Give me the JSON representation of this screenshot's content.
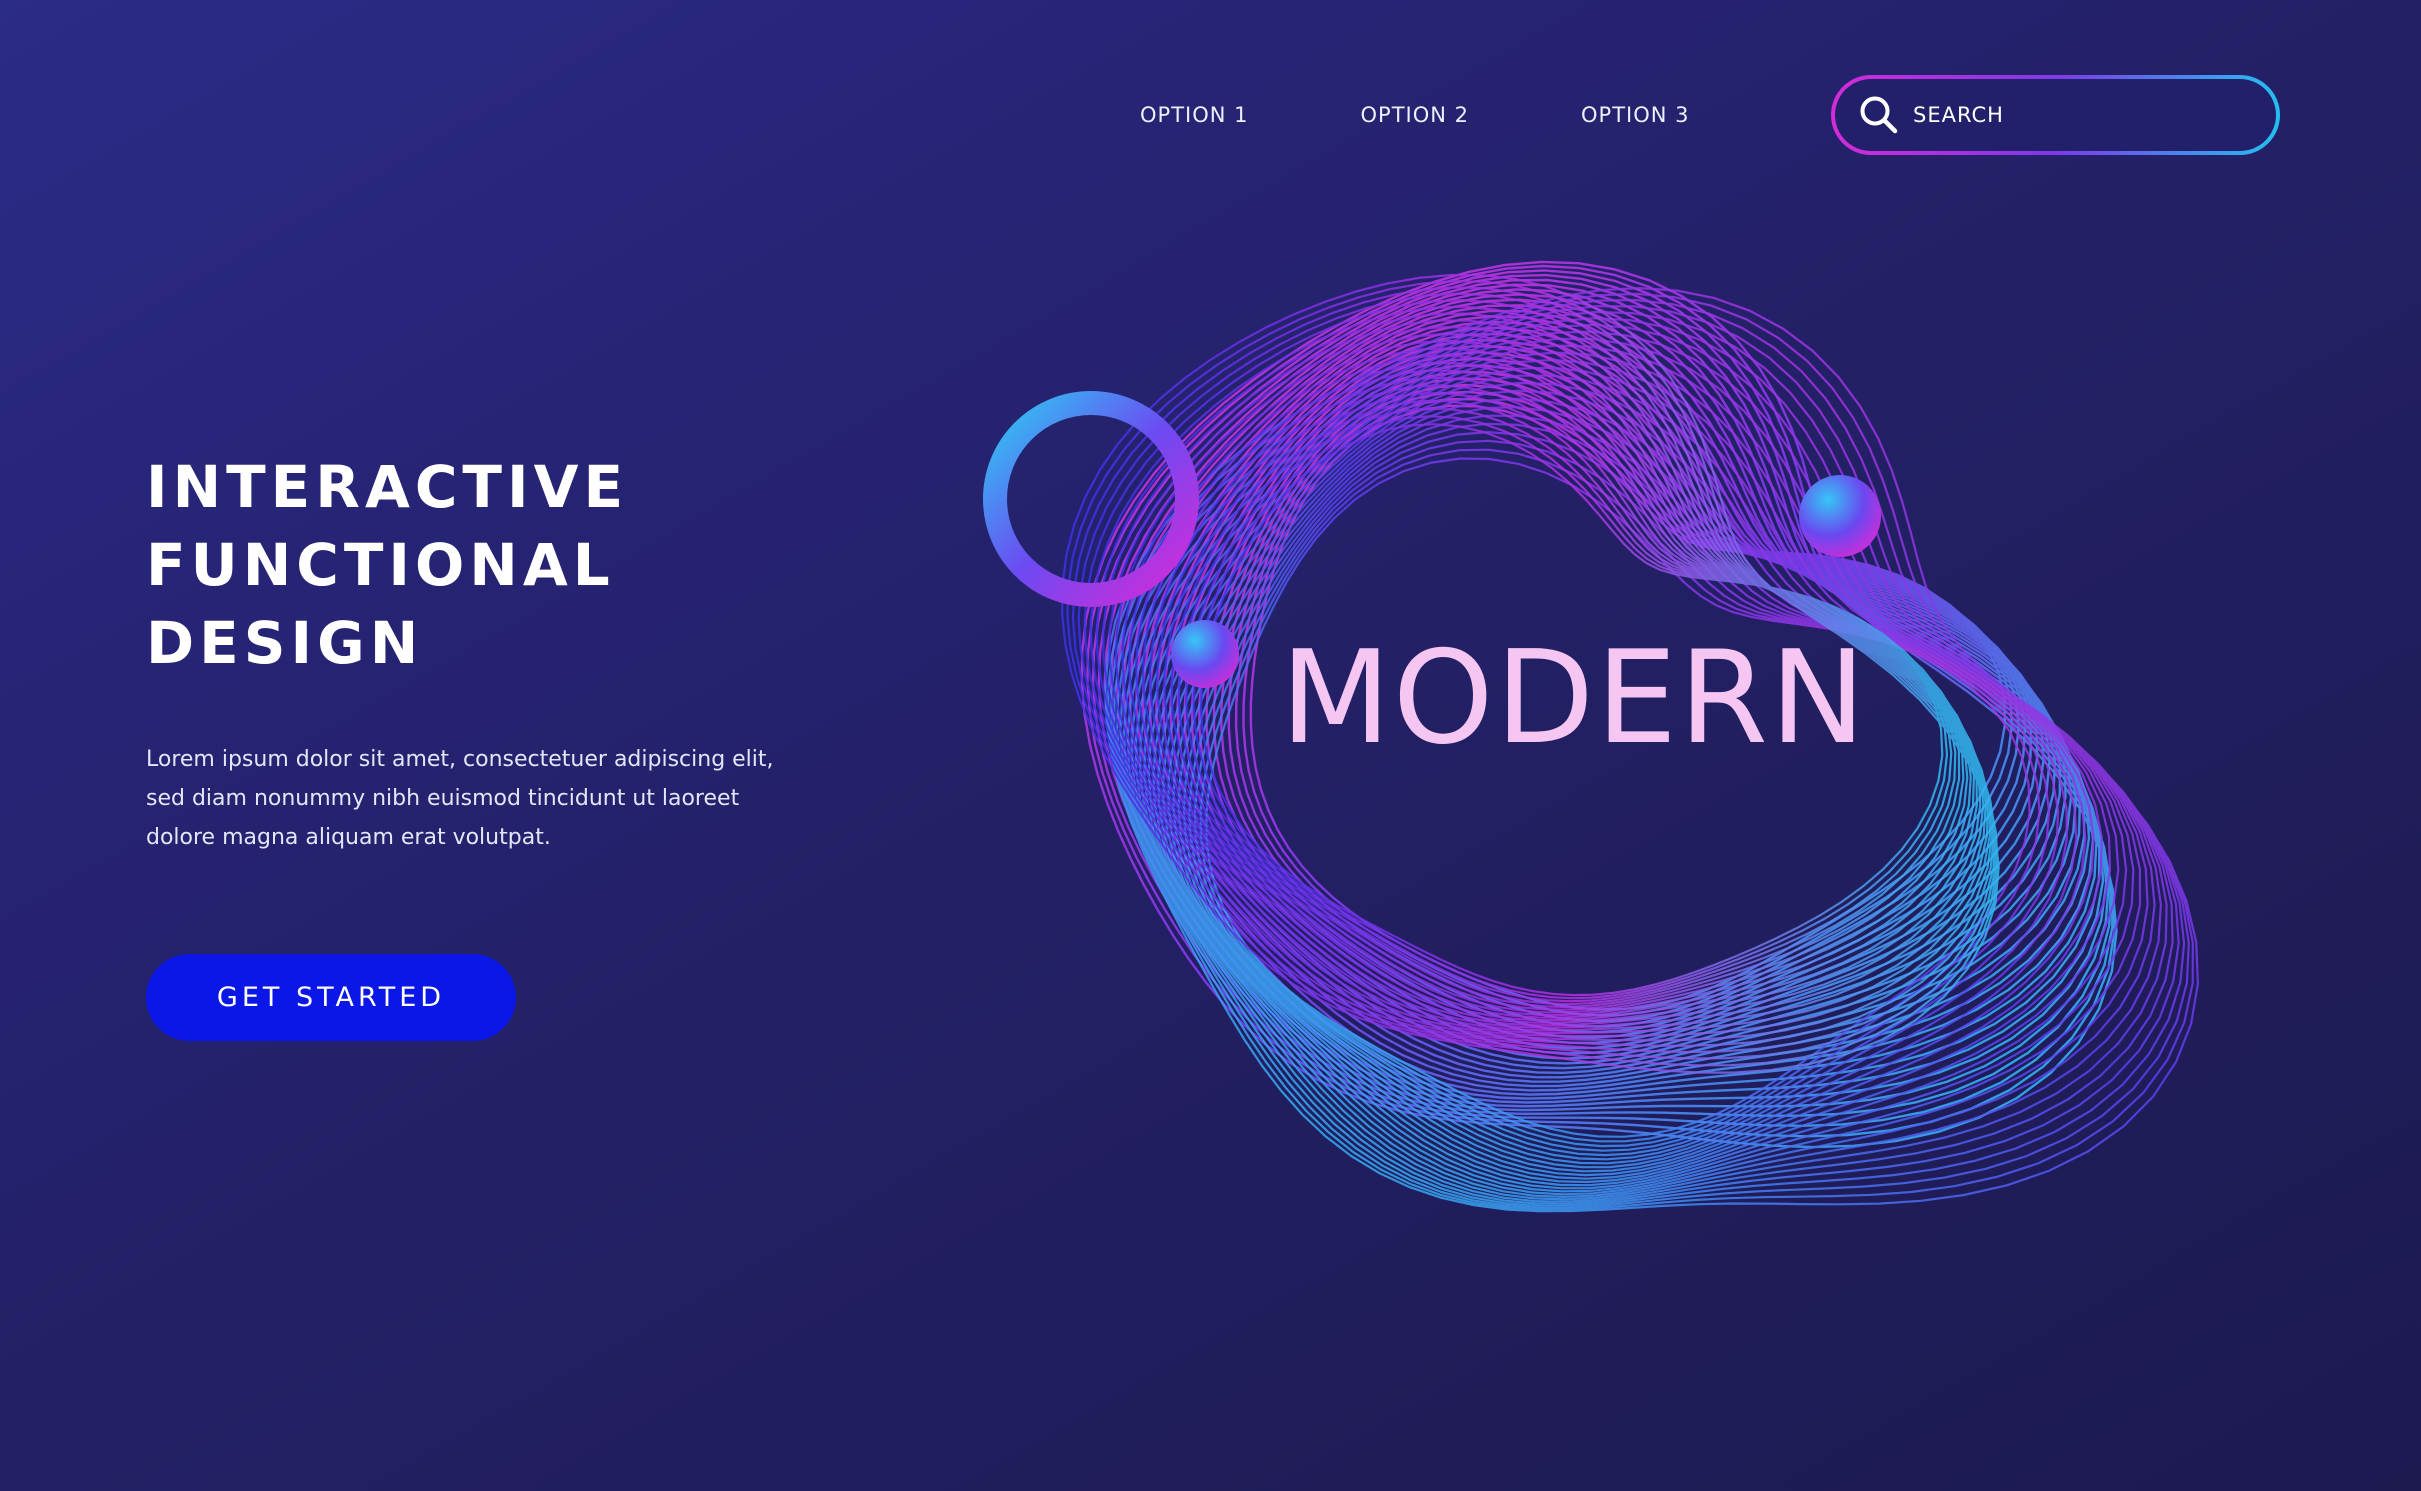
{
  "nav": {
    "items": [
      {
        "label": "OPTION 1"
      },
      {
        "label": "OPTION 2"
      },
      {
        "label": "OPTION 3"
      }
    ]
  },
  "search": {
    "placeholder": "SEARCH",
    "icon": "search-icon"
  },
  "hero": {
    "title_lines": [
      "INTERACTIVE",
      "FUNCTIONAL",
      "DESIGN"
    ],
    "body": "Lorem ipsum dolor sit amet, consectetuer adipiscing elit, sed diam nonummy nibh euismod tincidunt ut laoreet dolore magna aliquam erat volutpat.",
    "cta_label": "GET STARTED"
  },
  "artwork": {
    "word": "MODERN"
  },
  "colors": {
    "background": "#232169",
    "accent_blue": "#0a17e6",
    "accent_magenta": "#d42bd8",
    "accent_cyan": "#24c0f0",
    "word_color": "#f6c6f3"
  }
}
